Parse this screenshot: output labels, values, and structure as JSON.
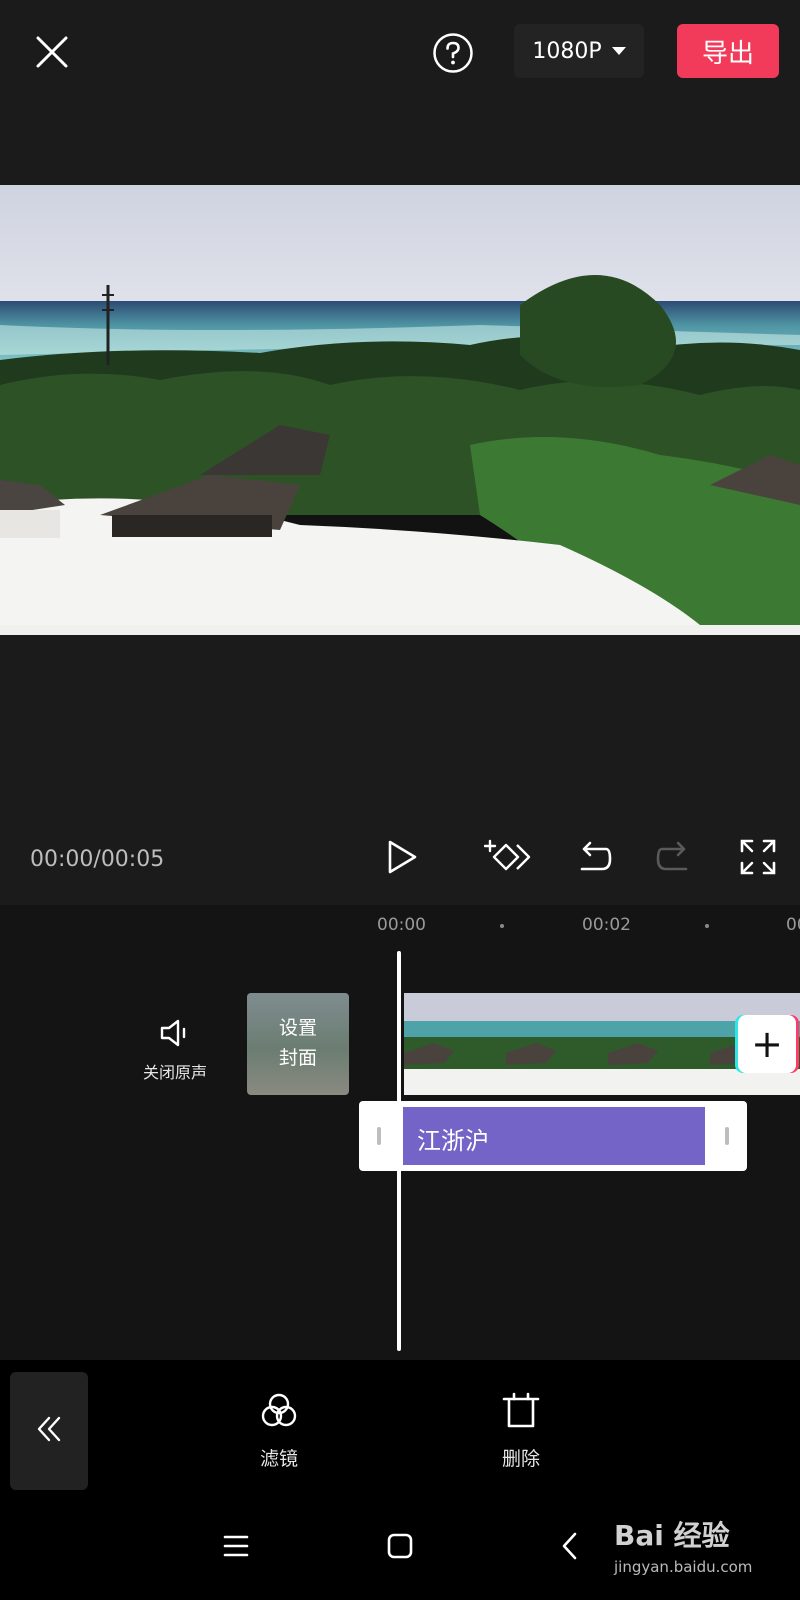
{
  "header": {
    "resolution": "1080P",
    "export_label": "导出"
  },
  "player": {
    "time_readout": "00:00/00:05"
  },
  "timeline": {
    "ruler": [
      "00:00",
      "00:02",
      "00"
    ],
    "mute_label": "关闭原声",
    "cover_label_line1": "设置",
    "cover_label_line2": "封面",
    "text_clip_label": "江浙沪"
  },
  "toolbar": {
    "filter_label": "滤镜",
    "delete_label": "删除"
  },
  "watermark": {
    "brand": "Bai  经验",
    "url": "jingyan.baidu.com"
  },
  "icons": {
    "close": "close-icon",
    "help": "help-icon",
    "play": "play-icon",
    "keyframe": "keyframe-icon",
    "undo": "undo-icon",
    "redo": "redo-icon",
    "fullscreen": "fullscreen-icon",
    "mute": "speaker-icon",
    "filter": "filter-icon",
    "delete": "crop-icon",
    "collapse": "double-chevron-left-icon",
    "nav_menu": "menu-icon",
    "nav_home": "home-icon",
    "nav_back": "back-icon"
  },
  "colors": {
    "export": "#f23a5a",
    "text_clip": "#7464c7",
    "background": "#121212"
  }
}
